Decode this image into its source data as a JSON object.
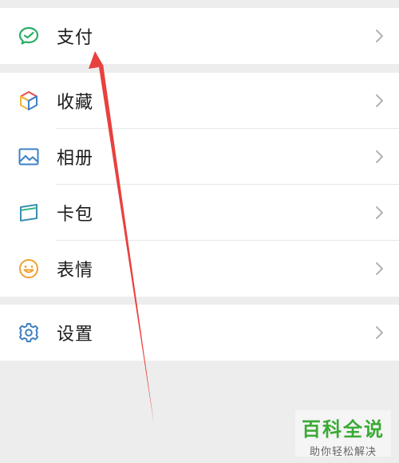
{
  "menu": {
    "group1": [
      {
        "label": "支付",
        "icon": "wechat-pay-icon"
      }
    ],
    "group2": [
      {
        "label": "收藏",
        "icon": "favorites-cube-icon"
      },
      {
        "label": "相册",
        "icon": "album-picture-icon"
      },
      {
        "label": "卡包",
        "icon": "card-wallet-icon"
      },
      {
        "label": "表情",
        "icon": "sticker-smile-icon"
      }
    ],
    "group3": [
      {
        "label": "设置",
        "icon": "settings-gear-icon"
      }
    ]
  },
  "annotation": {
    "arrow_color": "#e8413e"
  },
  "watermark": {
    "title": "百科全说",
    "subtitle": "助你轻松解决"
  },
  "colors": {
    "background": "#ededed",
    "row_bg": "#ffffff",
    "pay_green": "#2aae67",
    "album_blue": "#3c82c8",
    "card_teal": "#3a8fb0",
    "smile_orange": "#f0a030",
    "gear_blue": "#3f7fc0",
    "watermark_green": "#3aaa35"
  }
}
